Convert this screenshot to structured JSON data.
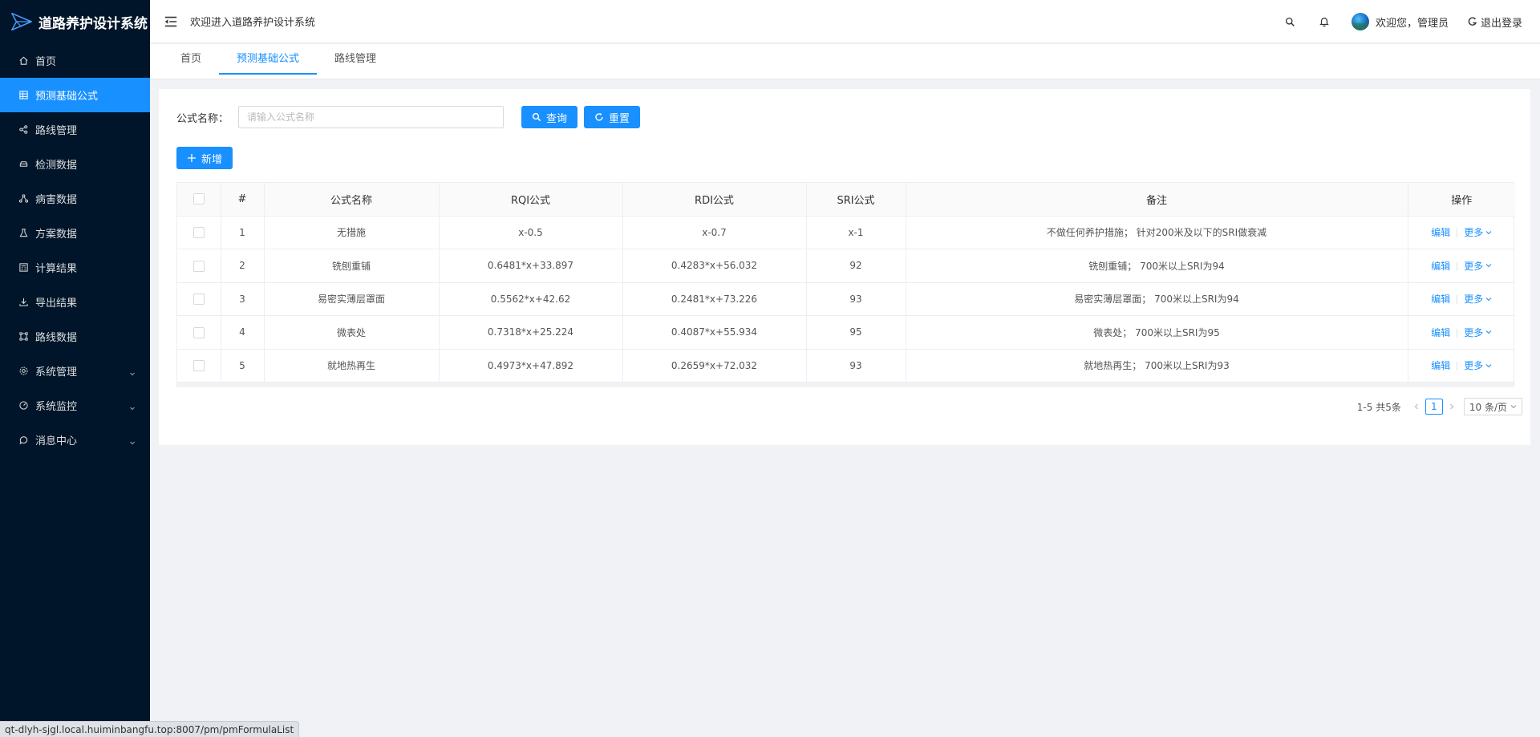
{
  "app": {
    "title": "道路养护设计系统"
  },
  "header": {
    "welcome": "欢迎进入道路养护设计系统",
    "user_greeting": "欢迎您，管理员",
    "logout": "退出登录"
  },
  "sidebar": {
    "items": [
      {
        "label": "首页",
        "icon": "home-icon"
      },
      {
        "label": "预测基础公式",
        "icon": "table-icon"
      },
      {
        "label": "路线管理",
        "icon": "share-icon"
      },
      {
        "label": "检测数据",
        "icon": "car-icon"
      },
      {
        "label": "病害数据",
        "icon": "cluster-icon"
      },
      {
        "label": "方案数据",
        "icon": "experiment-icon"
      },
      {
        "label": "计算结果",
        "icon": "calculator-icon"
      },
      {
        "label": "导出结果",
        "icon": "download-icon"
      },
      {
        "label": "路线数据",
        "icon": "node-icon"
      },
      {
        "label": "系统管理",
        "icon": "setting-icon"
      },
      {
        "label": "系统监控",
        "icon": "dashboard-icon"
      },
      {
        "label": "消息中心",
        "icon": "message-icon"
      }
    ],
    "active_index": 1
  },
  "tabs": [
    {
      "label": "首页"
    },
    {
      "label": "预测基础公式"
    },
    {
      "label": "路线管理"
    }
  ],
  "search": {
    "label": "公式名称：",
    "placeholder": "请输入公式名称",
    "value": "",
    "query_label": "查询",
    "reset_label": "重置"
  },
  "toolbar": {
    "add_label": "新增"
  },
  "table": {
    "columns": [
      "#",
      "公式名称",
      "RQI公式",
      "RDI公式",
      "SRI公式",
      "备注",
      "操作"
    ],
    "rows": [
      {
        "no": "1",
        "name": "无措施",
        "rqi": "x-0.5",
        "rdi": "x-0.7",
        "sri": "x-1",
        "note": "不做任何养护措施； 针对200米及以下的SRI做衰减"
      },
      {
        "no": "2",
        "name": "铣刨重铺",
        "rqi": "0.6481*x+33.897",
        "rdi": "0.4283*x+56.032",
        "sri": "92",
        "note": "铣刨重铺； 700米以上SRI为94"
      },
      {
        "no": "3",
        "name": "易密实薄层罩面",
        "rqi": "0.5562*x+42.62",
        "rdi": "0.2481*x+73.226",
        "sri": "93",
        "note": "易密实薄层罩面； 700米以上SRI为94"
      },
      {
        "no": "4",
        "name": "微表处",
        "rqi": "0.7318*x+25.224",
        "rdi": "0.4087*x+55.934",
        "sri": "95",
        "note": "微表处； 700米以上SRI为95"
      },
      {
        "no": "5",
        "name": "就地热再生",
        "rqi": "0.4973*x+47.892",
        "rdi": "0.2659*x+72.032",
        "sri": "93",
        "note": "就地热再生； 700米以上SRI为93"
      }
    ],
    "edit_label": "编辑",
    "more_label": "更多"
  },
  "pagination": {
    "total_text": "1-5 共5条",
    "current_page": "1",
    "page_size": "10 条/页"
  },
  "statusbar": {
    "url": "qt-dlyh-sjgl.local.huiminbangfu.top:8007/pm/pmFormulaList"
  }
}
